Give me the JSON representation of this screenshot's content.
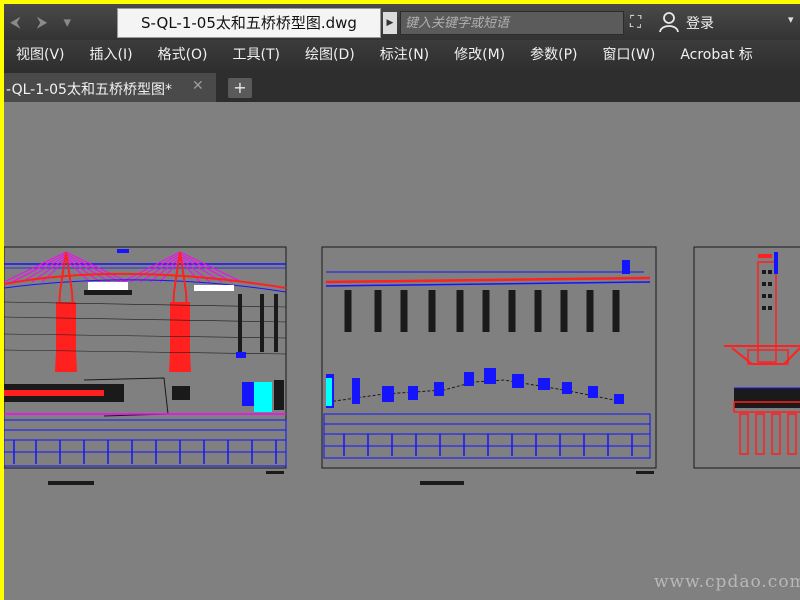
{
  "titlebar": {
    "qat_icons": [
      "back-arrow-icon",
      "forward-arrow-icon",
      "dropdown-icon"
    ],
    "document_title": "S-QL-1-05太和五桥桥型图.dwg",
    "search_placeholder": "键入关键字或短语",
    "login_label": "登录"
  },
  "menubar": {
    "items": [
      "视图(V)",
      "插入(I)",
      "格式(O)",
      "工具(T)",
      "绘图(D)",
      "标注(N)",
      "修改(M)",
      "参数(P)",
      "窗口(W)",
      "Acrobat 标"
    ]
  },
  "tabs": {
    "active_label": "-QL-1-05太和五桥桥型图*",
    "close_glyph": "✕",
    "add_glyph": "+"
  },
  "drawing": {
    "line_colors": {
      "blue": "#1414ff",
      "red": "#ff2020",
      "magenta": "#ff00ff",
      "cyan": "#00ffff"
    }
  },
  "watermark": "www.cpdao.com"
}
